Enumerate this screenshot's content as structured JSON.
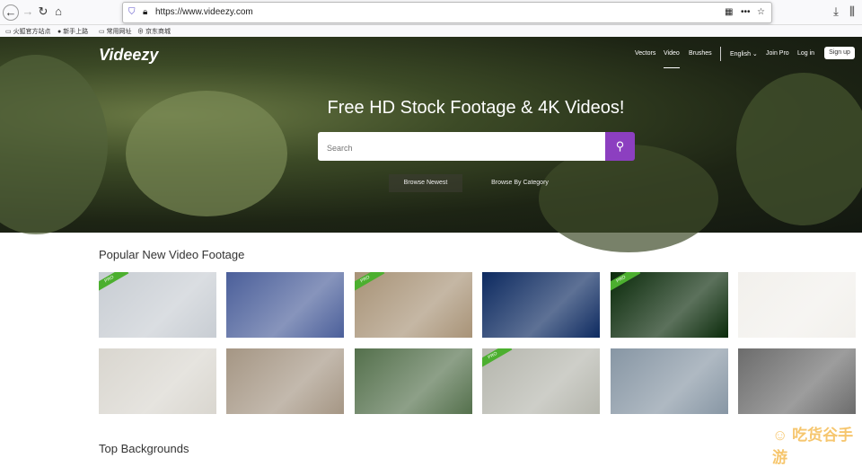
{
  "browser": {
    "url": "https://www.videezy.com",
    "bookmarks": [
      "火狐官方站点",
      "新手上路",
      "常用网址",
      "京东商城"
    ]
  },
  "site": {
    "logo": "Videezy",
    "nav": [
      "Vectors",
      "Video",
      "Brushes"
    ],
    "active_nav": "Video",
    "language": "English",
    "join_pro": "Join Pro",
    "login": "Log in",
    "signup": "Sign up"
  },
  "hero": {
    "headline": "Free HD Stock Footage & 4K Videos!",
    "search_placeholder": "Search",
    "browse_newest": "Browse Newest",
    "browse_category": "Browse By Category"
  },
  "section": {
    "title": "Popular New Video Footage",
    "next_title": "Top Backgrounds",
    "pro_label": "PRO"
  },
  "thumbnails": [
    {
      "desc": "scientist-microscope",
      "pro": true,
      "color": "#c8cdd3"
    },
    {
      "desc": "lab-glassware",
      "pro": false,
      "color": "#4b5f9a"
    },
    {
      "desc": "cafe-interior",
      "pro": true,
      "color": "#a89377"
    },
    {
      "desc": "virus-blue",
      "pro": false,
      "color": "#0d2a60"
    },
    {
      "desc": "green-sphere",
      "pro": true,
      "color": "#0a2a0a"
    },
    {
      "desc": "illustration-shopping",
      "pro": false,
      "color": "#f2f0ec"
    },
    {
      "desc": "laptop-typing",
      "pro": false,
      "color": "#d9d6cf"
    },
    {
      "desc": "man-on-couch",
      "pro": false,
      "color": "#a59684"
    },
    {
      "desc": "student-desk",
      "pro": false,
      "color": "#54704c"
    },
    {
      "desc": "woman-mask-thumbsup",
      "pro": true,
      "color": "#b5b6ad"
    },
    {
      "desc": "stressed-man-laptop",
      "pro": false,
      "color": "#8796a4"
    },
    {
      "desc": "cleaning-glove",
      "pro": false,
      "color": "#6c6c6c"
    }
  ],
  "watermark": "吃货谷手游"
}
